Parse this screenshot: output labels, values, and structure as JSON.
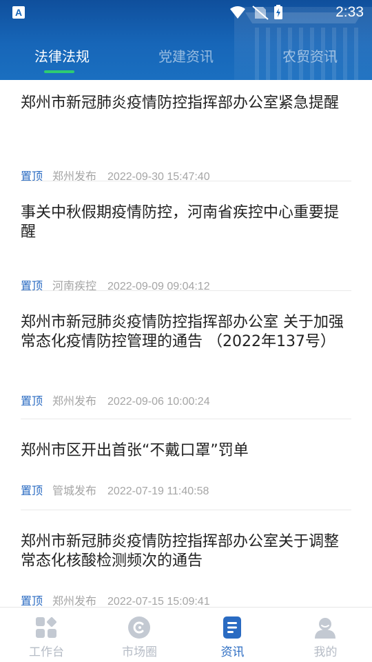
{
  "status_bar": {
    "time": "2:33",
    "app_glyph": "A"
  },
  "tabs": [
    {
      "label": "法律法规",
      "active": true
    },
    {
      "label": "党建资讯",
      "active": false
    },
    {
      "label": "农贸资讯",
      "active": false
    }
  ],
  "news": [
    {
      "title": "郑州市新冠肺炎疫情防控指挥部办公室紧急提醒",
      "tag": "置顶",
      "source": "郑州发布",
      "datetime": "2022-09-30 15:47:40"
    },
    {
      "title": "事关中秋假期疫情防控，河南省疾控中心重要提醒",
      "tag": "置顶",
      "source": "河南疾控",
      "datetime": "2022-09-09 09:04:12"
    },
    {
      "title": "郑州市新冠肺炎疫情防控指挥部办公室 关于加强常态化疫情防控管理的通告 （2022年137号）",
      "tag": "置顶",
      "source": "郑州发布",
      "datetime": "2022-09-06 10:00:24"
    },
    {
      "title": "郑州市区开出首张“不戴口罩”罚单",
      "tag": "置顶",
      "source": "管城发布",
      "datetime": "2022-07-19 11:40:58"
    },
    {
      "title": "郑州市新冠肺炎疫情防控指挥部办公室关于调整常态化核酸检测频次的通告",
      "tag": "置顶",
      "source": "郑州发布",
      "datetime": "2022-07-15 15:09:41"
    }
  ],
  "bottom_nav": [
    {
      "label": "工作台",
      "icon": "grid-icon",
      "active": false
    },
    {
      "label": "市场圈",
      "icon": "circle-c-icon",
      "active": false
    },
    {
      "label": "资讯",
      "icon": "document-icon",
      "active": true
    },
    {
      "label": "我的",
      "icon": "person-icon",
      "active": false
    }
  ],
  "colors": {
    "header": "#1766b8",
    "tab_indicator": "#2ecc71",
    "accent": "#2a6bc2",
    "nav_inactive": "#b6bcc6"
  }
}
